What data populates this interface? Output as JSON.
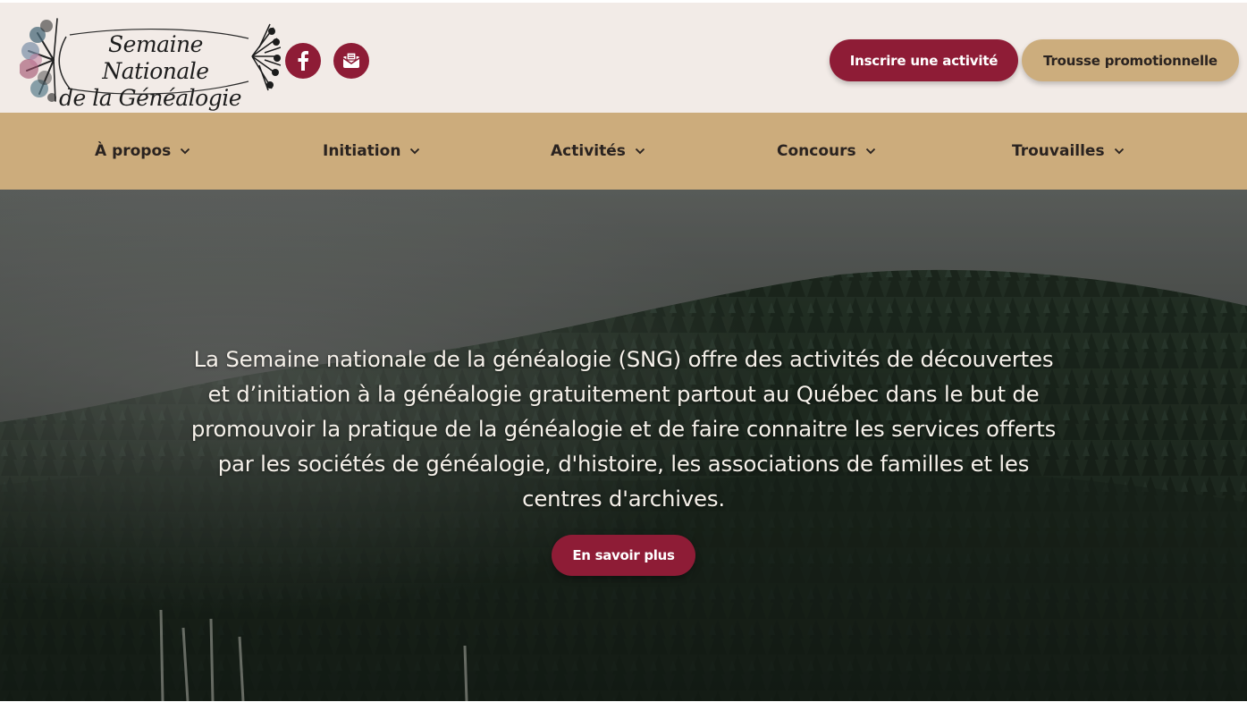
{
  "header": {
    "logo": {
      "line1": "Semaine Nationale",
      "line2": "de la Généalogie"
    },
    "social": [
      {
        "icon": "facebook-icon"
      },
      {
        "icon": "mail-icon"
      }
    ],
    "buttons": {
      "register_activity": "Inscrire une activité",
      "promo_kit": "Trousse promotionnelle"
    }
  },
  "nav": {
    "items": [
      {
        "label": "À propos"
      },
      {
        "label": "Initiation"
      },
      {
        "label": "Activités"
      },
      {
        "label": "Concours"
      },
      {
        "label": "Trouvailles"
      }
    ]
  },
  "hero": {
    "lines": [
      "La Semaine nationale de la généalogie (SNG) offre des activités de découvertes",
      "et d’initiation à la généalogie gratuitement partout au Québec dans le but de",
      "promouvoir la pratique de la généalogie et de faire connaitre les services offerts",
      "par les sociétés de généalogie, d'histoire, les associations de familles et les",
      "centres d'archives."
    ],
    "cta": "En savoir plus"
  },
  "colors": {
    "primary": "#8e1c36",
    "gold": "#ccac7c",
    "header_bg": "#f2ebe7",
    "text_dark": "#2a2320"
  }
}
